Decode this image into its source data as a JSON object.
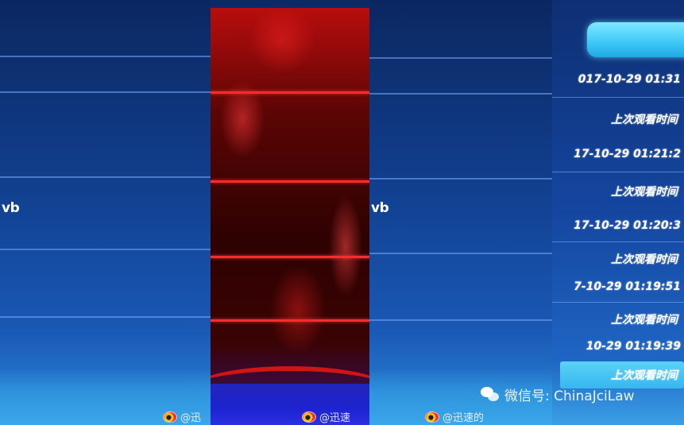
{
  "panels": {
    "left_text": "vb",
    "right_text": "vb"
  },
  "list": {
    "items": [
      {
        "date": "017-10-29 01:31",
        "label": "上次观看时间"
      },
      {
        "date": "17-10-29 01:21:2",
        "label": "上次观看时间"
      },
      {
        "date": "17-10-29 01:20:3",
        "label": "上次观看时间"
      },
      {
        "date": "7-10-29 01:19:51",
        "label": "上次观看时间"
      },
      {
        "date": "10-29 01:19:39",
        "label": "上次观看时间"
      }
    ]
  },
  "watermarks": {
    "wechat": "微信号: ChinaJciLaw",
    "weibo_left": "@迅",
    "weibo_mid": "@迅速",
    "weibo_right": "@迅速的"
  },
  "colors": {
    "accent": "#3cc7f5",
    "red_panel": "#b90d0d",
    "blue_panel": "#11408f"
  }
}
